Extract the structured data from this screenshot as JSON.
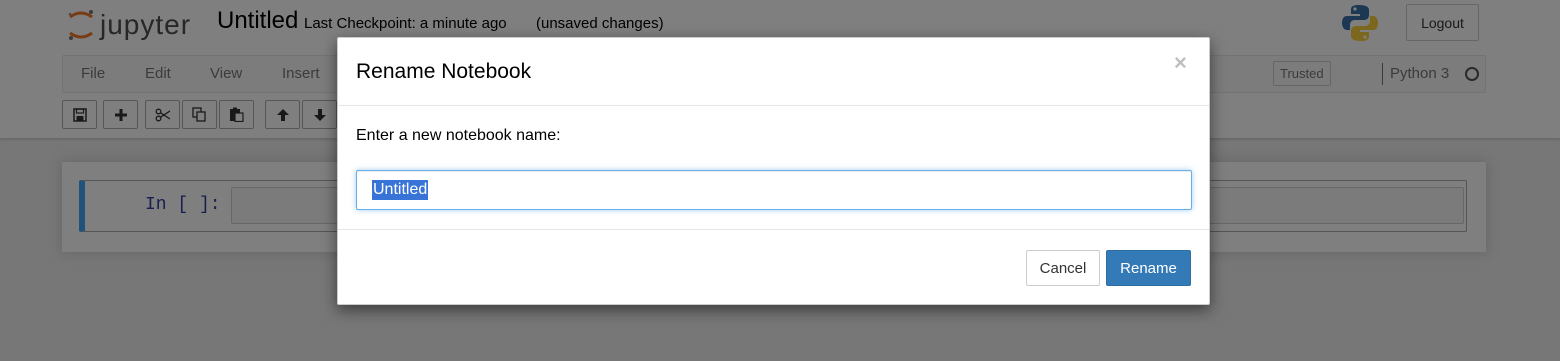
{
  "app": {
    "logo_text": "jupyter",
    "notebook_name": "Untitled",
    "checkpoint": "Last Checkpoint: a minute ago",
    "save_status": "(unsaved changes)",
    "logout_label": "Logout"
  },
  "menubar": {
    "items": [
      "File",
      "Edit",
      "View",
      "Insert"
    ],
    "trusted_label": "Trusted",
    "kernel_name": "Python 3"
  },
  "toolbar": {
    "icons": [
      "save-icon",
      "plus-icon",
      "cut-icon",
      "copy-icon",
      "paste-icon",
      "arrow-up-icon",
      "arrow-down-icon"
    ]
  },
  "cell": {
    "prompt": "In [ ]:"
  },
  "modal": {
    "title": "Rename Notebook",
    "close_glyph": "×",
    "label": "Enter a new notebook name:",
    "input_value": "Untitled",
    "cancel_label": "Cancel",
    "rename_label": "Rename"
  },
  "colors": {
    "accent": "#337ab7",
    "cell_border": "#42a5f5",
    "selection": "#3874d8",
    "logo_orange": "#f37726"
  }
}
